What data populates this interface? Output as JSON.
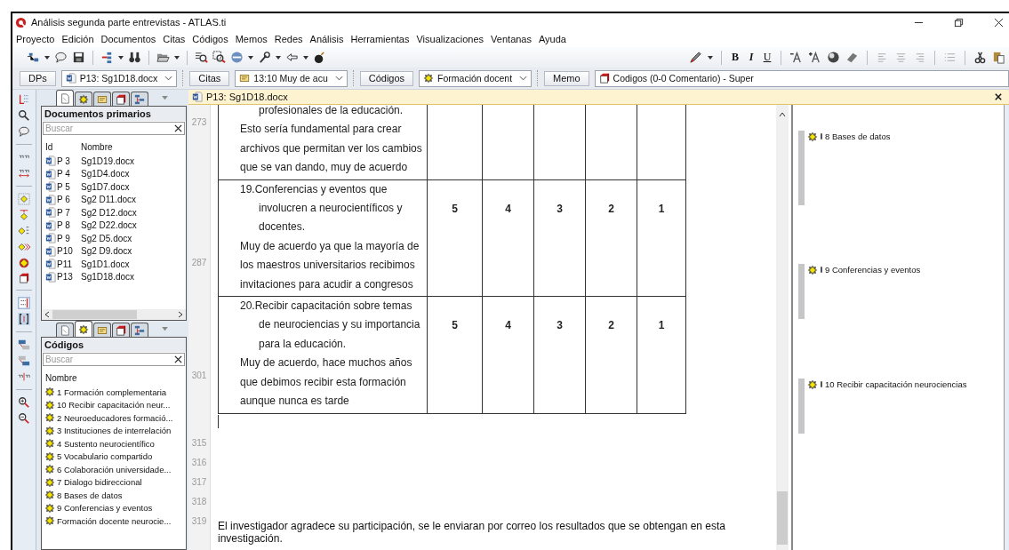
{
  "window": {
    "title": "Análisis segunda parte entrevistas - ATLAS.ti"
  },
  "menu": [
    "Proyecto",
    "Edición",
    "Documentos",
    "Citas",
    "Códigos",
    "Memos",
    "Redes",
    "Análisis",
    "Herramientas",
    "Visualizaciones",
    "Ventanas",
    "Ayuda"
  ],
  "format_buttons": [
    {
      "label": "B",
      "kind": "bold"
    },
    {
      "label": "I",
      "kind": "italic"
    },
    {
      "label": "U",
      "kind": "underline"
    }
  ],
  "selectors": [
    {
      "button": "DPs",
      "value": "P13: Sg1D18.docx",
      "kind": "document"
    },
    {
      "button": "Citas",
      "value": "13:10 Muy de acu",
      "kind": "quotation"
    },
    {
      "button": "Códigos",
      "value": "Formación docent",
      "kind": "code"
    }
  ],
  "memo": {
    "button": "Memo",
    "value": "Codigos (0-0 Comentario) - Super"
  },
  "documents_panel": {
    "tabs": [
      {
        "kind": "documents",
        "selected": true
      },
      {
        "kind": "codes",
        "selected": false
      },
      {
        "kind": "quotations",
        "selected": false
      },
      {
        "kind": "memos",
        "selected": false
      },
      {
        "kind": "networks",
        "selected": false
      }
    ],
    "title": "Documentos primarios",
    "search": {
      "placeholder": "Buscar"
    },
    "columns": [
      "Id",
      "Nombre"
    ],
    "rows": [
      {
        "id": "P 3",
        "name": "Sg1D19.docx"
      },
      {
        "id": "P 4",
        "name": "Sg1D4.docx"
      },
      {
        "id": "P 5",
        "name": "Sg1D7.docx"
      },
      {
        "id": "P 6",
        "name": "Sg2 D11.docx"
      },
      {
        "id": "P 7",
        "name": "Sg2 D12.docx"
      },
      {
        "id": "P 8",
        "name": "Sg2 D22.docx"
      },
      {
        "id": "P 9",
        "name": "Sg2 D5.docx"
      },
      {
        "id": "P10",
        "name": "Sg2 D9.docx"
      },
      {
        "id": "P11",
        "name": "Sg1D1.docx"
      },
      {
        "id": "P13",
        "name": "Sg1D18.docx"
      }
    ]
  },
  "codes_panel": {
    "tabs": [
      {
        "kind": "documents",
        "selected": false
      },
      {
        "kind": "codes",
        "selected": true
      },
      {
        "kind": "quotations",
        "selected": false
      },
      {
        "kind": "memos",
        "selected": false
      },
      {
        "kind": "networks",
        "selected": false
      }
    ],
    "title": "Códigos",
    "search": {
      "placeholder": "Buscar"
    },
    "column": "Nombre",
    "items": [
      "1 Formación complementaria",
      "10 Recibir capacitación neur...",
      "2 Neuroeducadores formació...",
      "3 Instituciones de interrelación",
      "4 Sustento neurocientífico",
      "5 Vocabulario compartido",
      "6 Colaboración universidade...",
      "7  Dialogo bidireccional",
      "8 Bases de datos",
      "9 Conferencias y eventos",
      "Formación docente neurocie..."
    ]
  },
  "document": {
    "tab": "P13: Sg1D18.docx",
    "line_numbers": [
      "273",
      "287",
      "301",
      "315",
      "316",
      "317",
      "318",
      "319"
    ],
    "table_rows": [
      {
        "number": "",
        "question": "profesionales de la educación.",
        "answer": "Esto sería fundamental para crear archivos que permitan ver los cambios que se van dando, muy de acuerdo",
        "scores": []
      },
      {
        "number": "19.",
        "question": "Conferencias y eventos que involucren a neurocientíficos y docentes.",
        "answer": "Muy de acuerdo ya que la mayoría de los maestros universitarios recibimos invitaciones para acudir a congresos",
        "scores": [
          "5",
          "4",
          "3",
          "2",
          "1"
        ]
      },
      {
        "number": "20.",
        "question": "Recibir capacitación sobre temas de neurociencias y su importancia para la educación.",
        "answer": "Muy de acuerdo, hace muchos años que debimos recibir esta formación aunque nunca es tarde",
        "scores": [
          "5",
          "4",
          "3",
          "2",
          "1"
        ]
      }
    ],
    "closing": "El investigador agradece su participación, se le enviaran por correo los resultados que se obtengan en esta investigación."
  },
  "margin_codes": [
    "8 Bases de datos",
    "9 Conferencias y eventos",
    "10 Recibir capacitación neurociencias"
  ]
}
